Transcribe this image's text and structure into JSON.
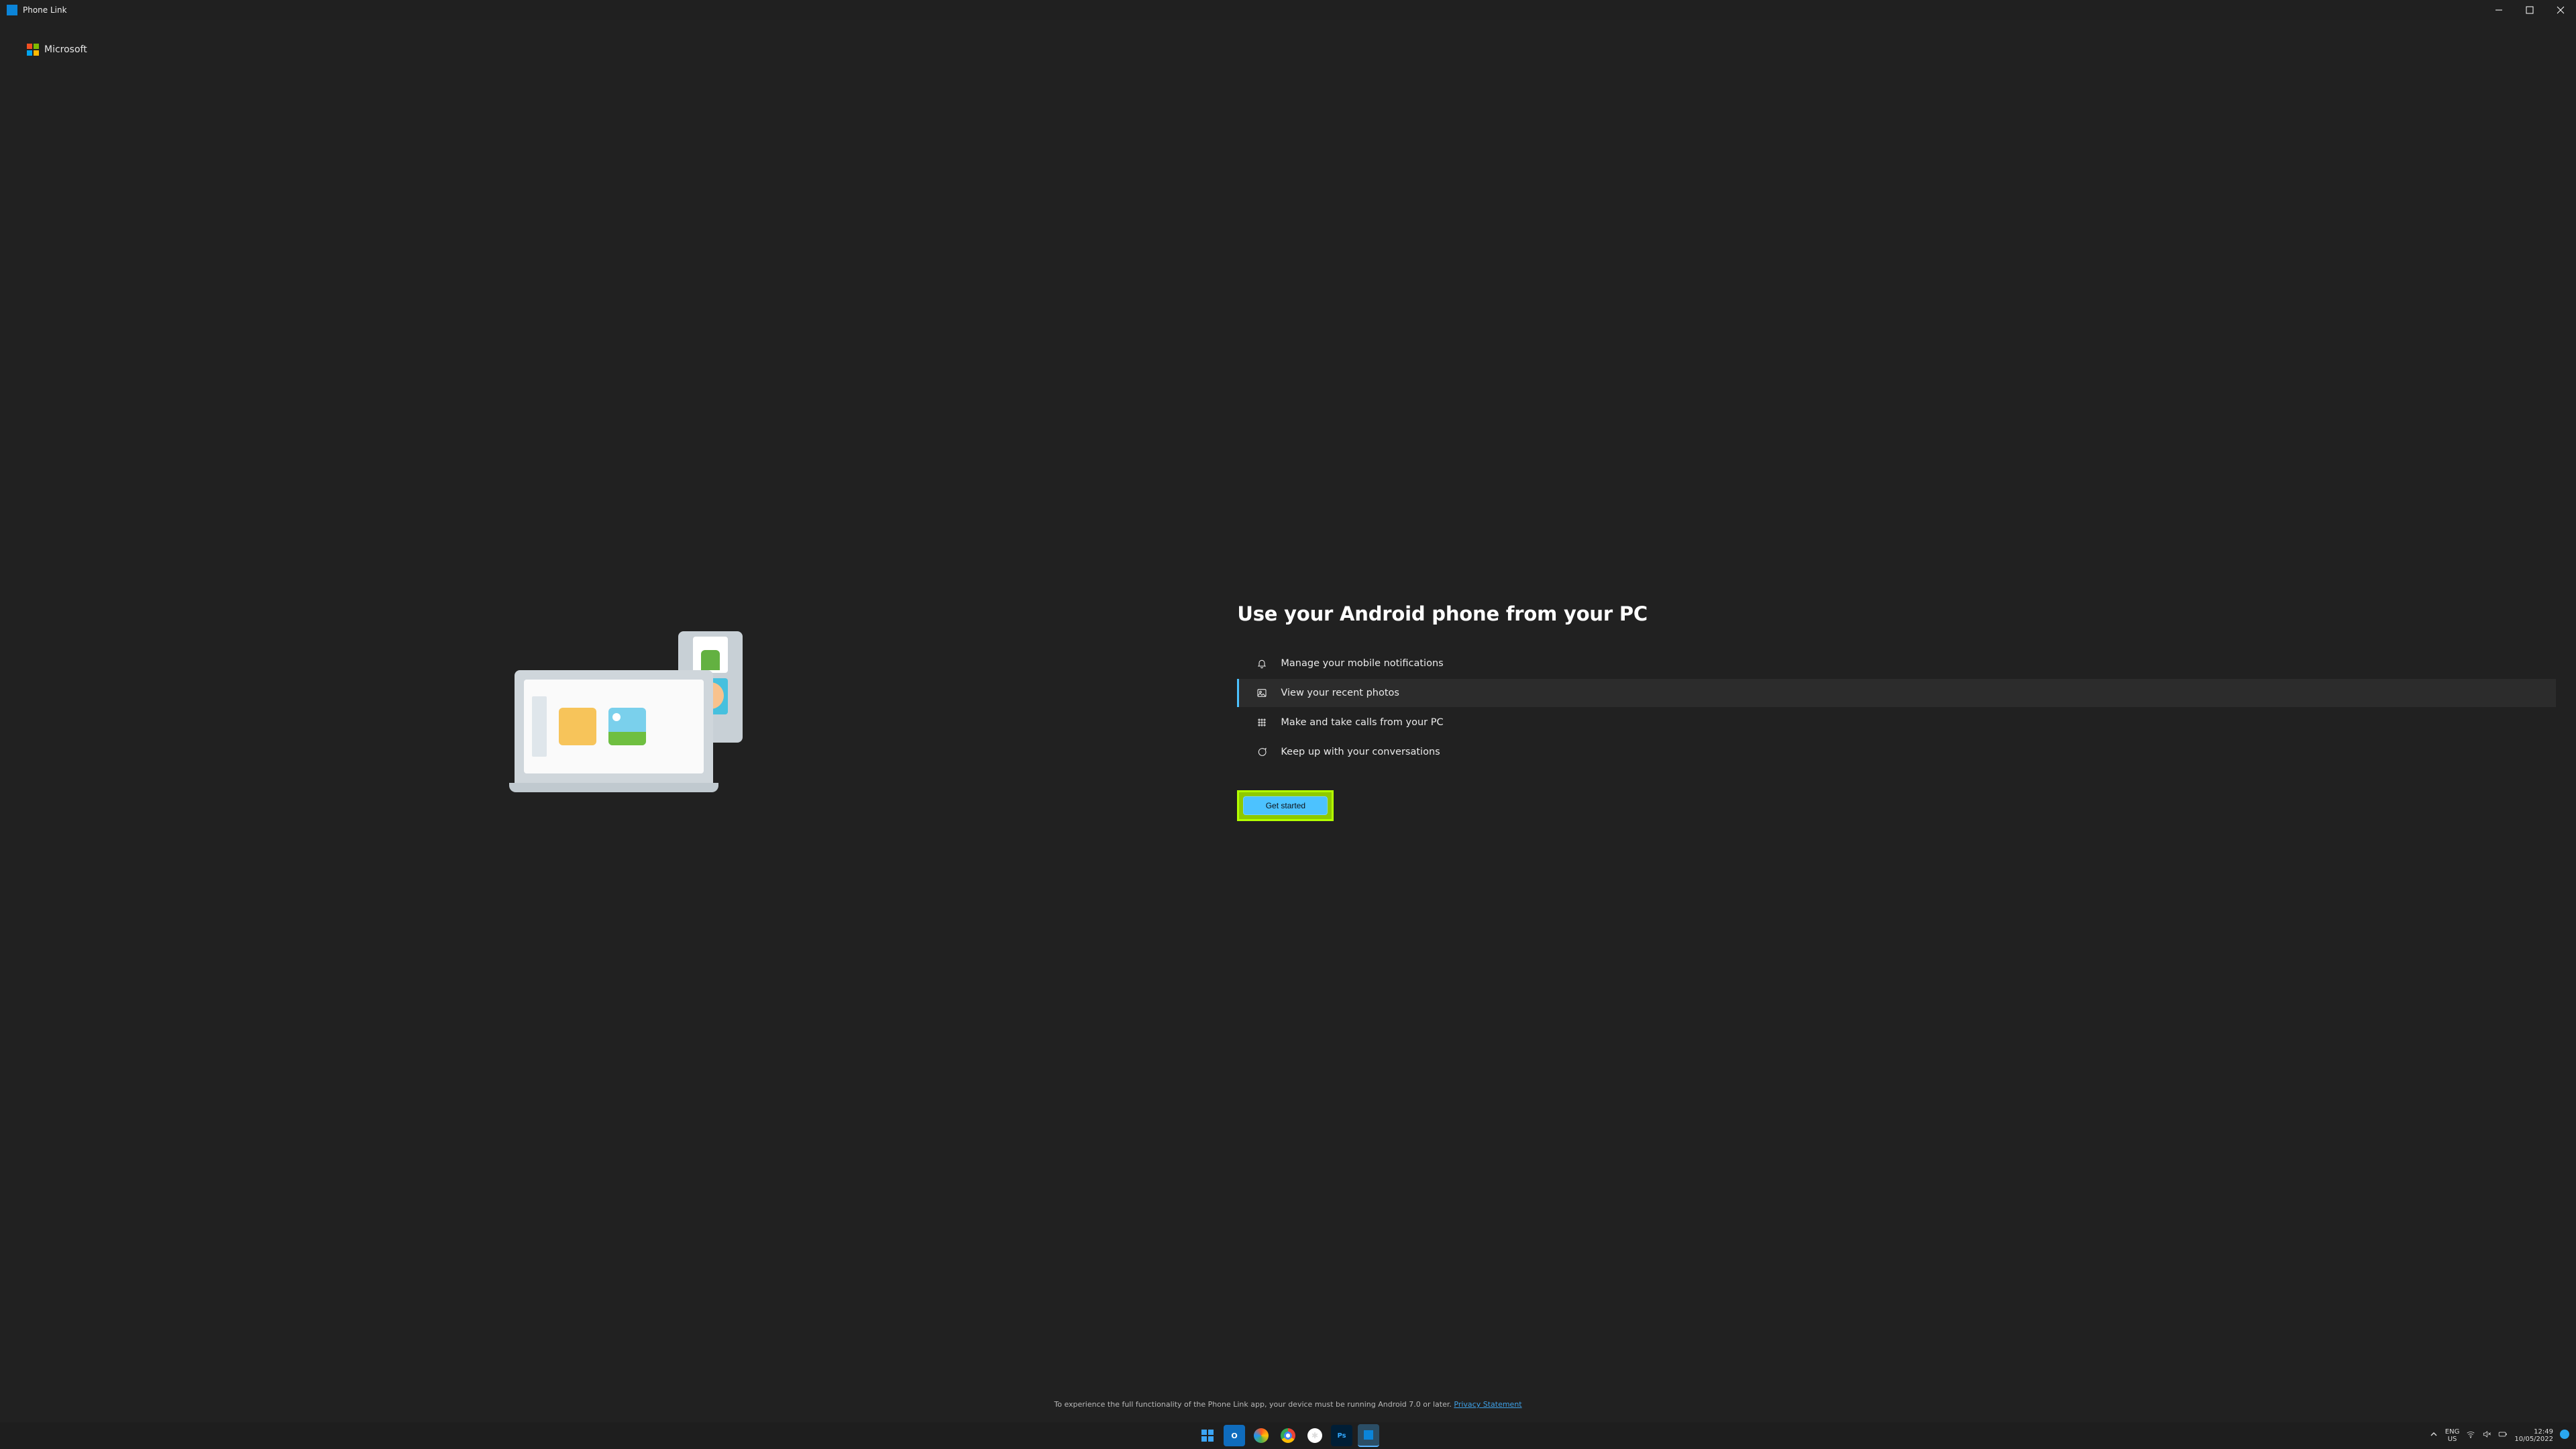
{
  "window": {
    "title": "Phone Link"
  },
  "brand": {
    "label": "Microsoft"
  },
  "hero": {
    "title": "Use your Android phone from your PC",
    "features": [
      {
        "label": "Manage your mobile notifications",
        "icon": "bell-icon",
        "active": false
      },
      {
        "label": "View your recent photos",
        "icon": "photo-icon",
        "active": true
      },
      {
        "label": "Make and take calls from your PC",
        "icon": "dialpad-icon",
        "active": false
      },
      {
        "label": "Keep up with your conversations",
        "icon": "chat-icon",
        "active": false
      }
    ],
    "cta": "Get started"
  },
  "footer": {
    "text": "To experience the full functionality of the Phone Link app, your device must be running Android 7.0 or later. ",
    "link_text": "Privacy Statement"
  },
  "taskbar": {
    "lang_top": "ENG",
    "lang_bottom": "US",
    "time": "12:49",
    "date": "10/05/2022"
  }
}
